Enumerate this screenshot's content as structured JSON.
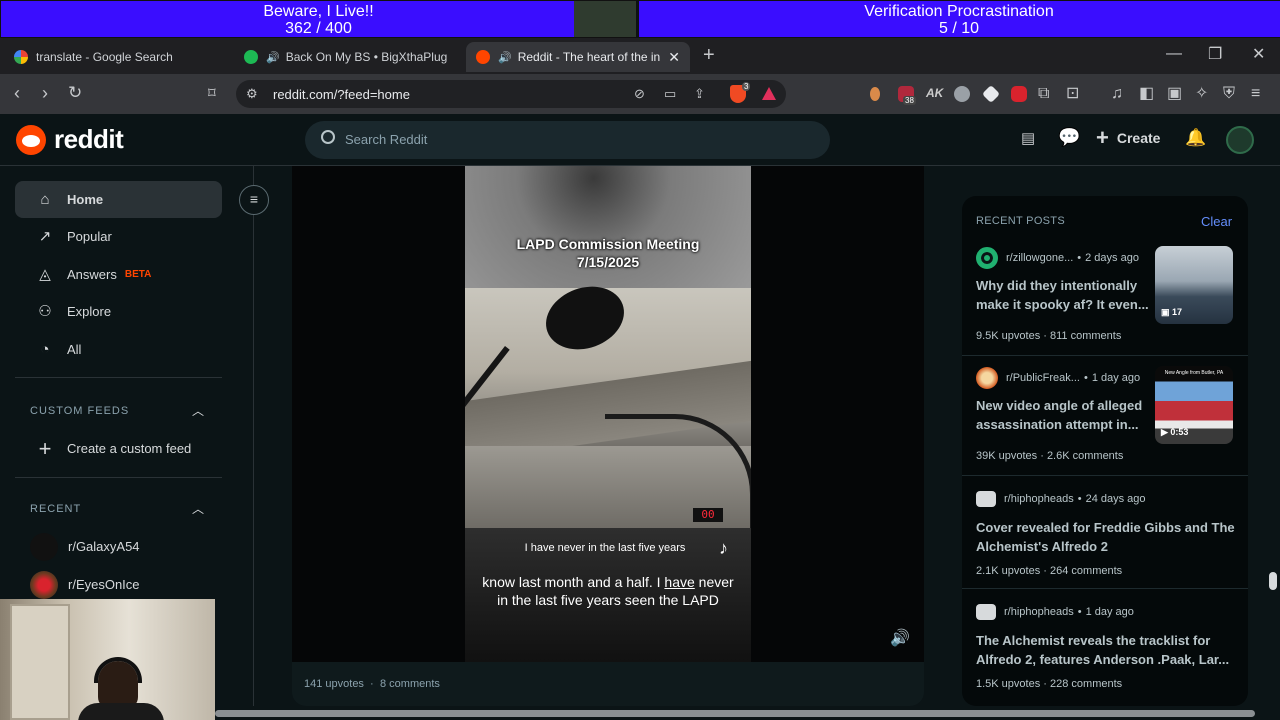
{
  "overlay": {
    "left": {
      "title": "Beware, I Live!!",
      "progress_text": "362 / 400",
      "progress": 0.905
    },
    "right": {
      "title": "Verification Procrastination",
      "progress_text": "5 / 10",
      "progress": 0.5
    }
  },
  "tabs": [
    {
      "label": "translate - Google Search"
    },
    {
      "label": "Back On My BS • BigXthaPlug"
    },
    {
      "label": "Reddit - The heart of the inter"
    }
  ],
  "address": {
    "url": "reddit.com/?feed=home"
  },
  "extensions": {
    "badge_count": "38",
    "brave_count": "3"
  },
  "reddit": {
    "logo": "reddit",
    "search_placeholder": "Search Reddit",
    "create_label": "Create"
  },
  "sidebar": {
    "nav": [
      {
        "label": "Home",
        "icon": "home-icon"
      },
      {
        "label": "Popular",
        "icon": "popular-icon"
      },
      {
        "label": "Answers",
        "icon": "answers-icon",
        "badge": "BETA"
      },
      {
        "label": "Explore",
        "icon": "explore-icon"
      },
      {
        "label": "All",
        "icon": "all-icon"
      }
    ],
    "custom_feeds_heading": "CUSTOM FEEDS",
    "create_feed_label": "Create a custom feed",
    "recent_heading": "RECENT",
    "recent": [
      {
        "label": "r/GalaxyA54"
      },
      {
        "label": "r/EyesOnIce"
      }
    ]
  },
  "post": {
    "video_title_line1": "LAPD Commission Meeting",
    "video_title_line2": "7/15/2025",
    "tiktok_caption": "I have never in the last five years",
    "subtitle_line1_pre": "know last month and a half. I ",
    "subtitle_line1_em": "have",
    "subtitle_line1_post": " never",
    "subtitle_line2": "in the last five years seen the LAPD",
    "display_counter": "00",
    "upvotes": "141 upvotes",
    "comments": "8 comments"
  },
  "recent_posts": {
    "heading": "RECENT POSTS",
    "clear_label": "Clear",
    "items": [
      {
        "subreddit": "r/zillowgone...",
        "age": "2 days ago",
        "title": "Why did they intentionally make it spooky af? It even...",
        "upvotes": "9.5K upvotes",
        "comments": "811 comments",
        "thumb_label": "17"
      },
      {
        "subreddit": "r/PublicFreak...",
        "age": "1 day ago",
        "title": "New video angle of alleged assassination attempt in...",
        "upvotes": "39K upvotes",
        "comments": "2.6K comments",
        "thumb_label": "0:53",
        "thumb_caption": "New Angle from Butler, PA"
      },
      {
        "subreddit": "r/hiphopheads",
        "age": "24 days ago",
        "title": "Cover revealed for Freddie Gibbs and The Alchemist's Alfredo 2",
        "upvotes": "2.1K upvotes",
        "comments": "264 comments"
      },
      {
        "subreddit": "r/hiphopheads",
        "age": "1 day ago",
        "title": "The Alchemist reveals the tracklist for Alfredo 2, features Anderson .Paak, Lar...",
        "upvotes": "1.5K upvotes",
        "comments": "228 comments"
      }
    ]
  },
  "colors": {
    "overlay_fill": "#3a0dff",
    "reddit_orange": "#ff4500",
    "link_blue": "#648efc",
    "beta_red": "#ff4500"
  }
}
